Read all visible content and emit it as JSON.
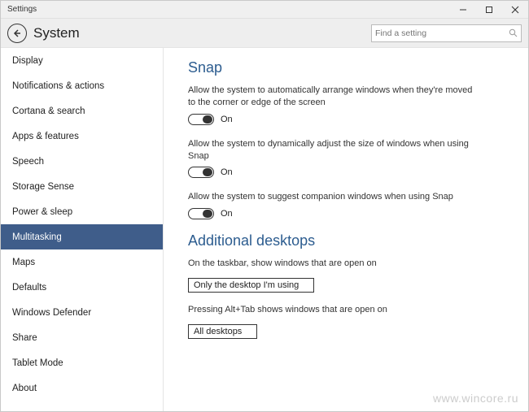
{
  "window": {
    "title": "Settings"
  },
  "header": {
    "page_title": "System",
    "search_placeholder": "Find a setting"
  },
  "sidebar": {
    "items": [
      {
        "label": "Display"
      },
      {
        "label": "Notifications & actions"
      },
      {
        "label": "Cortana & search"
      },
      {
        "label": "Apps & features"
      },
      {
        "label": "Speech"
      },
      {
        "label": "Storage Sense"
      },
      {
        "label": "Power & sleep"
      },
      {
        "label": "Multitasking",
        "selected": true
      },
      {
        "label": "Maps"
      },
      {
        "label": "Defaults"
      },
      {
        "label": "Windows Defender"
      },
      {
        "label": "Share"
      },
      {
        "label": "Tablet Mode"
      },
      {
        "label": "About"
      }
    ]
  },
  "content": {
    "snap": {
      "heading": "Snap",
      "opt1_desc": "Allow the system to automatically arrange windows when they're moved to the corner or edge of the screen",
      "opt1_state": "On",
      "opt2_desc": "Allow the system to dynamically adjust the size of windows when using Snap",
      "opt2_state": "On",
      "opt3_desc": "Allow the system to suggest companion windows when using Snap",
      "opt3_state": "On"
    },
    "desktops": {
      "heading": "Additional desktops",
      "opt1_desc": "On the taskbar, show windows that are open on",
      "opt1_value": "Only the desktop I'm using",
      "opt2_desc": "Pressing Alt+Tab shows windows that are open on",
      "opt2_value": "All desktops"
    }
  },
  "watermark": "www.wincore.ru"
}
